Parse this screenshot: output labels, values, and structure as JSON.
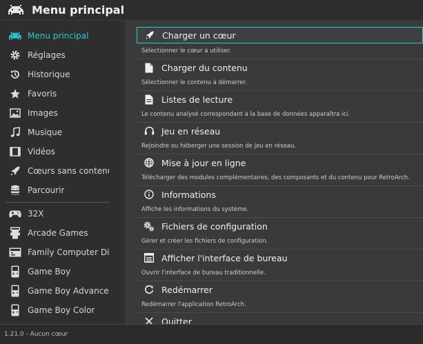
{
  "header": {
    "title": "Menu principal",
    "logo_icon": "retroarch-invader-icon"
  },
  "sidebar": {
    "items": [
      {
        "label": "Menu principal",
        "icon": "invader-icon",
        "active": true
      },
      {
        "label": "Réglages",
        "icon": "gear-icon"
      },
      {
        "label": "Historique",
        "icon": "history-icon"
      },
      {
        "label": "Favoris",
        "icon": "star-icon"
      },
      {
        "label": "Images",
        "icon": "image-icon"
      },
      {
        "label": "Musique",
        "icon": "music-icon"
      },
      {
        "label": "Vidéos",
        "icon": "video-icon"
      },
      {
        "label": "Cœurs sans contenu",
        "icon": "rocket-icon"
      },
      {
        "label": "Parcourir",
        "icon": "database-icon"
      },
      {
        "label": "32X",
        "icon": "gamepad-icon"
      },
      {
        "label": "Arcade Games",
        "icon": "arcade-icon"
      },
      {
        "label": "Family Computer Di...",
        "icon": "disk-system-icon"
      },
      {
        "label": "Game Boy",
        "icon": "gameboy-icon"
      },
      {
        "label": "Game Boy Advance",
        "icon": "gameboy-advance-icon"
      },
      {
        "label": "Game Boy Color",
        "icon": "gameboy-color-icon"
      }
    ]
  },
  "main": {
    "entries": [
      {
        "label": "Charger un cœur",
        "desc": "Sélectionner le cœur à utiliser.",
        "icon": "rocket-icon",
        "selected": true
      },
      {
        "label": "Charger du contenu",
        "desc": "Sélectionner le contenu à démarrer.",
        "icon": "file-icon"
      },
      {
        "label": "Listes de lecture",
        "desc": "Le contenu analysé correspondant à la base de données apparaîtra ici.",
        "icon": "playlist-icon"
      },
      {
        "label": "Jeu en réseau",
        "desc": "Rejoindre ou héberger une session de jeu en réseau.",
        "icon": "headset-icon"
      },
      {
        "label": "Mise à jour en ligne",
        "desc": "Télécharger des modules complémentaires, des composants et du contenu pour RetroArch.",
        "icon": "globe-icon"
      },
      {
        "label": "Informations",
        "desc": "Affiche les informations du système.",
        "icon": "info-icon"
      },
      {
        "label": "Fichiers de configuration",
        "desc": "Gérer et créer les fichiers de configuration.",
        "icon": "gears-icon"
      },
      {
        "label": "Afficher l'interface de bureau",
        "desc": "Ouvrir l'interface de bureau traditionnelle.",
        "icon": "desktop-icon"
      },
      {
        "label": "Redémarrer",
        "desc": "Redémarrer l'application RetroArch.",
        "icon": "restart-icon"
      },
      {
        "label": "Quitter",
        "desc": "",
        "icon": "close-icon"
      }
    ]
  },
  "footer": {
    "status": "1.21.0 - Aucun cœur"
  },
  "colors": {
    "accent": "#2ec7d0",
    "background": "#3a3a3a",
    "sidebar": "#2e2e2e"
  }
}
